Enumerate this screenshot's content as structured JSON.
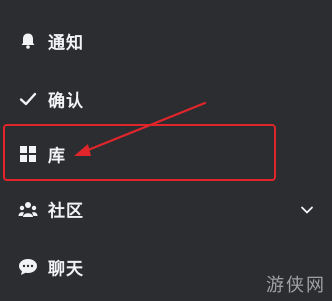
{
  "menu": {
    "items": [
      {
        "label": "通知",
        "icon": "bell-icon"
      },
      {
        "label": "确认",
        "icon": "check-icon"
      },
      {
        "label": "库",
        "icon": "grid-icon"
      },
      {
        "label": "社区",
        "icon": "community-icon",
        "expandable": true
      },
      {
        "label": "聊天",
        "icon": "chat-icon"
      }
    ]
  },
  "annotation": {
    "highlight_target": "库",
    "color": "#e0252b"
  },
  "watermark": {
    "text": "游侠网"
  },
  "colors": {
    "background": "#2b2d31",
    "text": "#f2f3f5",
    "annotation": "#e0252b"
  }
}
